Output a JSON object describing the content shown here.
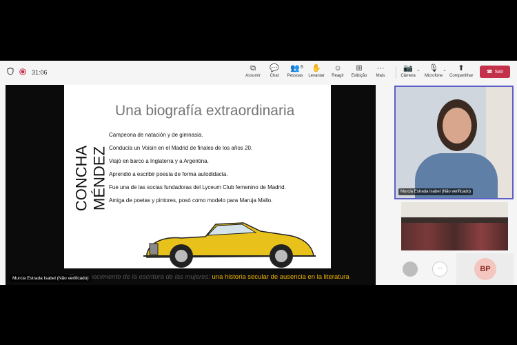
{
  "toolbar": {
    "timer": "31:06",
    "tools": [
      {
        "label": "Assumir",
        "icon": "share-control-icon"
      },
      {
        "label": "Chat",
        "icon": "chat-icon"
      },
      {
        "label": "Pessoas",
        "icon": "people-icon",
        "count": "6"
      },
      {
        "label": "Levantar",
        "icon": "raise-hand-icon"
      },
      {
        "label": "Reagir",
        "icon": "react-icon"
      },
      {
        "label": "Exibição",
        "icon": "view-icon"
      },
      {
        "label": "Mais",
        "icon": "more-icon"
      },
      {
        "label": "Câmera",
        "icon": "camera-off-icon"
      },
      {
        "label": "Microfone",
        "icon": "mic-off-icon"
      },
      {
        "label": "Compartilhar",
        "icon": "share-icon"
      }
    ],
    "leave_label": "Sair"
  },
  "slide": {
    "vertical_title": "CONCHA MÉNDEZ",
    "title": "Una biografía extraordinaria",
    "bullets": [
      "Campeona de natación y de gimnasia.",
      "Conducía un Voisin en el Madrid de finales de los años 20.",
      "Viajó en barco a Inglaterra y a Argentina.",
      "Aprendió a escribir poesía de forma autodidacta.",
      "Fue una de las socias fundadoras del Lyceum Club femenino de Madrid.",
      "Amiga de poetas y pintores, posó como modelo para Maruja Mallo."
    ]
  },
  "caption": {
    "prefix": "El reconocimiento de la escritura de las mujeres: ",
    "highlight": "una historia secular de ausencia en la literatura"
  },
  "presenter_label": "Murcia Estrada Isabel (Não verificado)",
  "camera_label": "Murcia Estrada Isabel (Não verificado)",
  "participant_initials": "BP",
  "colors": {
    "accent": "#5b5fc7",
    "leave": "#c4314b",
    "caption_highlight": "#f0b400",
    "car_yellow": "#e8c21a"
  }
}
